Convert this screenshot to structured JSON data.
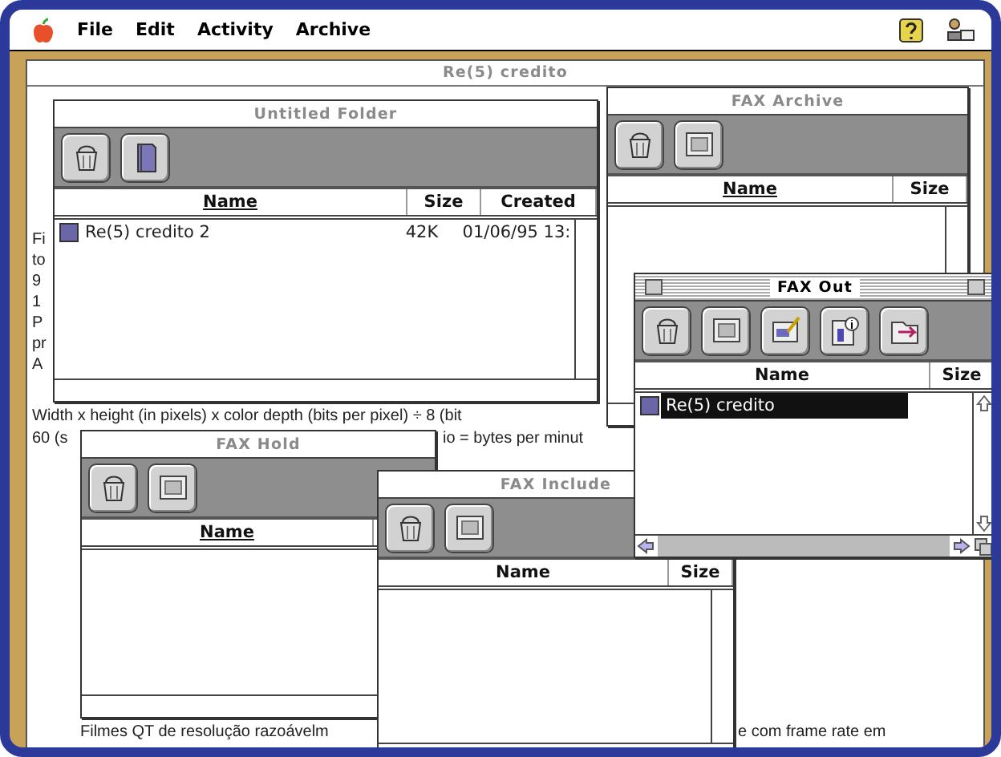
{
  "menu_bar": {
    "items": [
      "File",
      "Edit",
      "Activity",
      "Archive"
    ]
  },
  "document": {
    "title": "Re(5) credito",
    "fragments": [
      "Fi",
      "to",
      "9",
      "1",
      "P",
      "pr",
      "A"
    ],
    "lines": [
      "Width x height (in pixels) x color depth (bits per pixel) ÷ 8 (bit",
      "60 (s",
      "io = bytes per minut",
      "Filmes QT de resolução razoávelm",
      "e com frame rate em"
    ]
  },
  "windows": [
    {
      "title": "Untitled Folder",
      "active": false,
      "tools": [
        {
          "kind": "trash"
        },
        {
          "kind": "book"
        }
      ],
      "columns": [
        {
          "label": "Name",
          "sorted": true
        },
        {
          "label": "Size",
          "sorted": false
        },
        {
          "label": "Created",
          "sorted": false
        }
      ],
      "rows": [
        {
          "cells": [
            "Re(5)  credito 2",
            "42K",
            "01/06/95 13:"
          ],
          "selected": false
        }
      ]
    },
    {
      "title": "FAX Archive",
      "active": false,
      "tools": [
        {
          "kind": "trash"
        },
        {
          "kind": "page"
        }
      ],
      "columns": [
        {
          "label": "Name",
          "sorted": true
        },
        {
          "label": "Size",
          "sorted": false
        }
      ]
    },
    {
      "title": "FAX Hold",
      "active": false,
      "tools": [
        {
          "kind": "trash"
        },
        {
          "kind": "page"
        }
      ],
      "columns": [
        {
          "label": "Name",
          "sorted": true
        }
      ]
    },
    {
      "title": "FAX Include",
      "active": false,
      "tools": [
        {
          "kind": "trash"
        },
        {
          "kind": "page"
        }
      ],
      "columns": [
        {
          "label": "Name",
          "sorted": false
        },
        {
          "label": "Size",
          "sorted": false
        }
      ]
    },
    {
      "title": "FAX Out",
      "active": true,
      "tools": [
        {
          "kind": "trash"
        },
        {
          "kind": "page"
        },
        {
          "kind": "note"
        },
        {
          "kind": "info"
        },
        {
          "kind": "send"
        }
      ],
      "columns": [
        {
          "label": "Name",
          "sorted": false
        },
        {
          "label": "Size",
          "sorted": false
        }
      ],
      "rows": [
        {
          "cells": [
            "Re(5)  credito",
            ""
          ],
          "selected": true
        }
      ]
    }
  ]
}
